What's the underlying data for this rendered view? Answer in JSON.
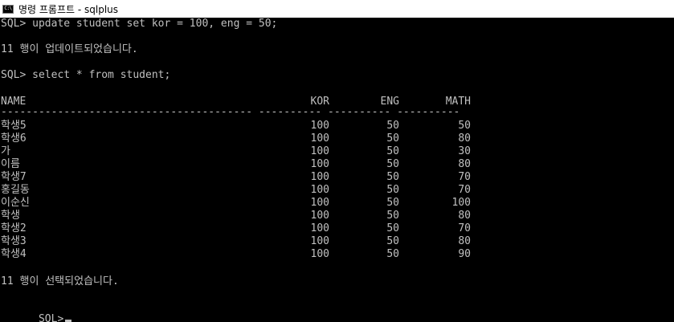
{
  "window": {
    "title": "명령 프롬프트 - sqlplus",
    "icon_label": "C:\\"
  },
  "console": {
    "update_command": "SQL> update student set kor = 100, eng = 50;",
    "update_result": "11 행이 업데이트되었습니다.",
    "select_command": "SQL> select * from student;",
    "headers": [
      "NAME",
      "KOR",
      "ENG",
      "MATH"
    ],
    "separator": "---------------------------------------- ---------- ---------- ----------",
    "rows": [
      [
        "학생5",
        "100",
        "50",
        "50"
      ],
      [
        "학생6",
        "100",
        "50",
        "80"
      ],
      [
        "가",
        "100",
        "50",
        "30"
      ],
      [
        "이름",
        "100",
        "50",
        "80"
      ],
      [
        "학생7",
        "100",
        "50",
        "70"
      ],
      [
        "홍길동",
        "100",
        "50",
        "70"
      ],
      [
        "이순신",
        "100",
        "50",
        "100"
      ],
      [
        "학생",
        "100",
        "50",
        "80"
      ],
      [
        "학생2",
        "100",
        "50",
        "70"
      ],
      [
        "학생3",
        "100",
        "50",
        "80"
      ],
      [
        "학생4",
        "100",
        "50",
        "90"
      ]
    ],
    "select_result": "11 행이 선택되었습니다.",
    "prompt": "SQL>"
  },
  "colors": {
    "background": "#000000",
    "text": "#c0c0c0",
    "titlebar": "#ffffff"
  }
}
